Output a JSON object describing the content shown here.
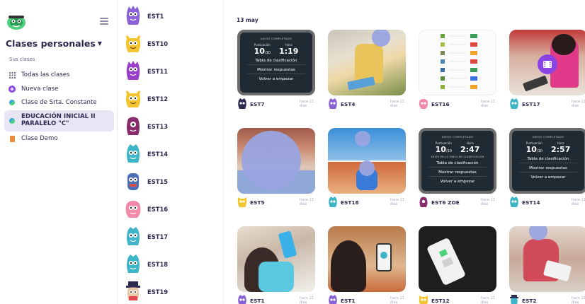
{
  "sidebar": {
    "classes_header": "Clases personales",
    "section_label": "Sus clases",
    "items": [
      {
        "label": "Todas las clases",
        "icon": "grid-icon"
      },
      {
        "label": "Nueva clase",
        "icon": "plus-circle-icon"
      },
      {
        "label": "Clase de Srta. Constante",
        "icon": "globe-icon"
      },
      {
        "label": "EDUCACIÓN INICIAL II PARALELO \"C\"",
        "icon": "globe-icon"
      },
      {
        "label": "Clase Demo",
        "icon": "book-icon"
      }
    ]
  },
  "students": [
    {
      "name": "EST1",
      "color": "#8b62d6"
    },
    {
      "name": "EST10",
      "color": "#f2c531"
    },
    {
      "name": "EST11",
      "color": "#9a3fc7"
    },
    {
      "name": "EST12",
      "color": "#f2c531"
    },
    {
      "name": "EST13",
      "color": "#8a2b6e"
    },
    {
      "name": "EST14",
      "color": "#3fb5c9"
    },
    {
      "name": "EST15",
      "color": "#4c6fb5"
    },
    {
      "name": "EST16",
      "color": "#f08aa8"
    },
    {
      "name": "EST17",
      "color": "#3fb5c9"
    },
    {
      "name": "EST18",
      "color": "#3fb5c9"
    },
    {
      "name": "EST19",
      "color": "#2c2a50"
    }
  ],
  "feed": {
    "date": "13 may",
    "game_screen": {
      "header": "JUEGO COMPLETADO",
      "score_label": "Puntuación",
      "time_label": "Hora",
      "table_btn": "Tabla de clasificación",
      "answers_btn": "Mostrar respuestas",
      "restart_btn": "Volver a empezar",
      "rank_note": "SEXTA EN LA TABLA DE CLASIFICACIÓN"
    },
    "cards": [
      {
        "student": "EST7",
        "ago": "hace 11 días",
        "kind": "game",
        "score": "10",
        "out_of": "/10",
        "time": "1:19"
      },
      {
        "student": "EST4",
        "ago": "hace 11 días",
        "kind": "photo"
      },
      {
        "student": "EST16",
        "ago": "hace 11 días",
        "kind": "worksheet"
      },
      {
        "student": "EST17",
        "ago": "hace 11 días",
        "kind": "video"
      },
      {
        "student": "EST5",
        "ago": "hace 11 días",
        "kind": "photo"
      },
      {
        "student": "EST18",
        "ago": "hace 11 días",
        "kind": "photo"
      },
      {
        "student": "EST6 ZOE",
        "ago": "hace 11 días",
        "kind": "game",
        "score": "10",
        "out_of": "/10",
        "time": "2:47"
      },
      {
        "student": "EST14",
        "ago": "hace 11 días",
        "kind": "game",
        "score": "10",
        "out_of": "/10",
        "time": "2:57"
      },
      {
        "student": "EST1",
        "ago": "hace 11 días",
        "kind": "photo"
      },
      {
        "student": "EST1",
        "ago": "hace 11 días",
        "kind": "photo"
      },
      {
        "student": "EST12",
        "ago": "hace 11 días",
        "kind": "photo"
      },
      {
        "student": "EST2",
        "ago": "hace 11 días",
        "kind": "photo"
      }
    ]
  },
  "colors": {
    "accent": "#8a44e6",
    "text": "#2c2a50",
    "active_bg": "#e8e6f5",
    "game_bg": "#1f2a33"
  }
}
